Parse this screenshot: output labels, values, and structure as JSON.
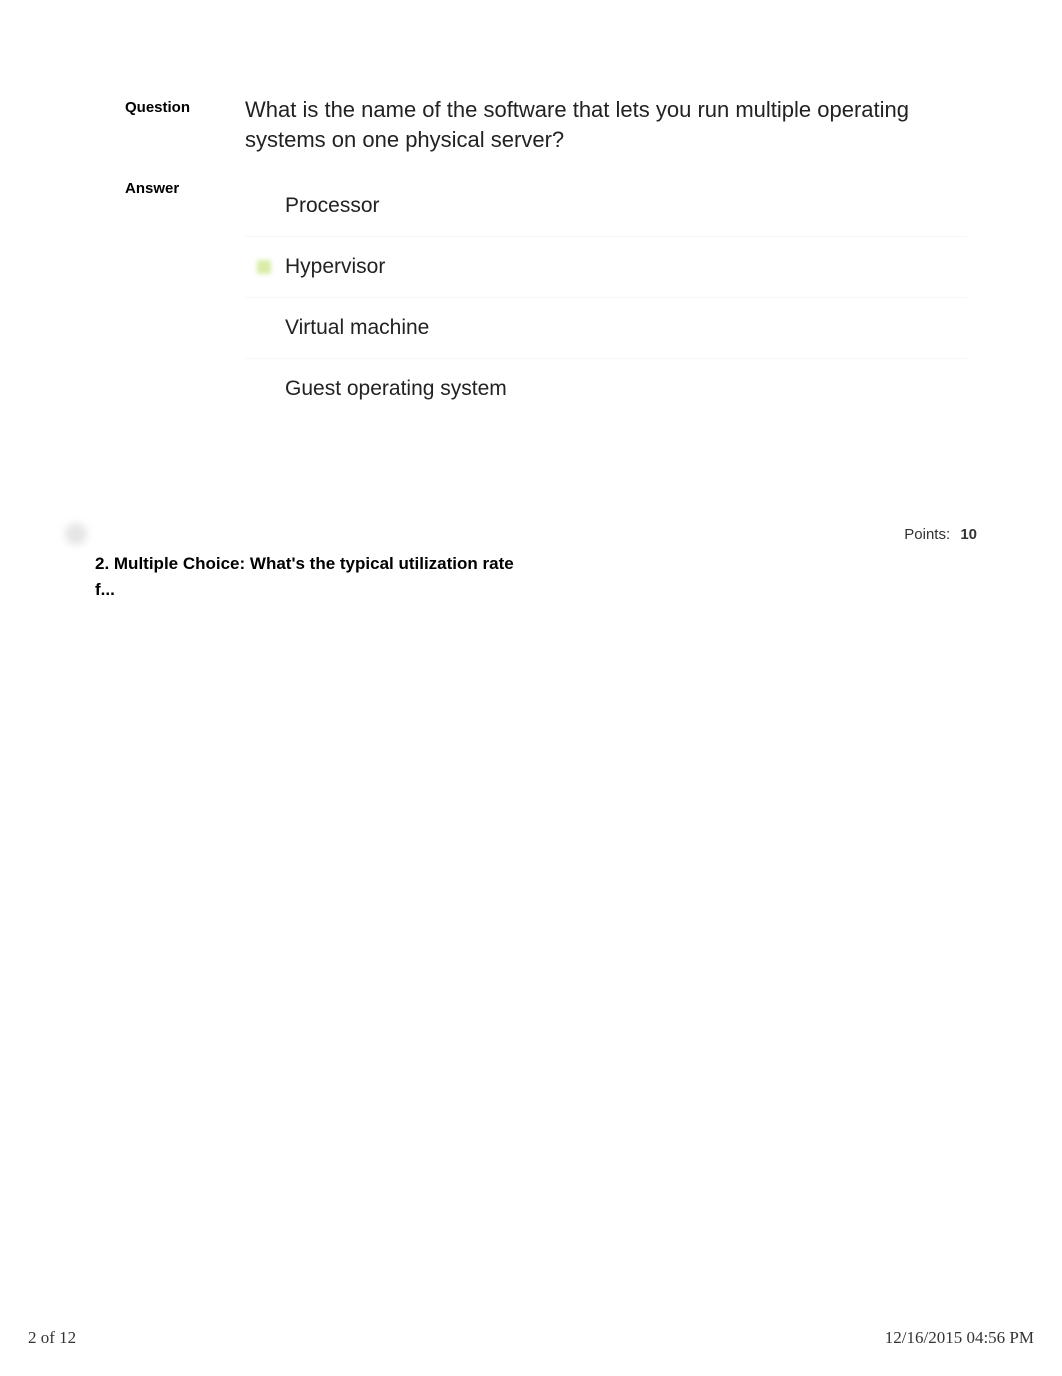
{
  "question_card": {
    "question_label": "Question",
    "question_text": "What is the name of the software that lets you run multiple operating systems on one physical server?",
    "answer_label": "Answer",
    "options": [
      {
        "text": "Processor",
        "highlighted": false
      },
      {
        "text": "Hypervisor",
        "highlighted": true
      },
      {
        "text": "Virtual machine",
        "highlighted": false
      },
      {
        "text": "Guest operating system",
        "highlighted": false
      }
    ]
  },
  "next_question": {
    "points_label": "Points:",
    "points_value": "10",
    "title_line1": "2. Multiple Choice: What's the typical utilization rate",
    "title_line2": "f..."
  },
  "footer": {
    "page_indicator": "2 of 12",
    "timestamp": "12/16/2015 04:56 PM"
  }
}
